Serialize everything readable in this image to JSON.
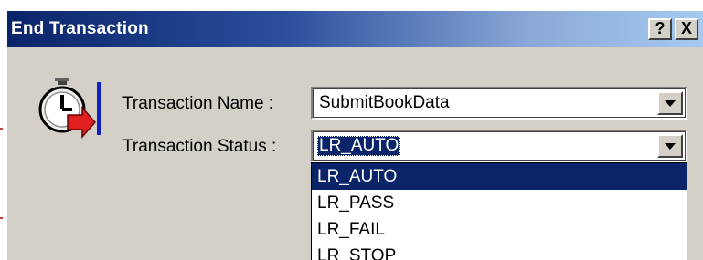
{
  "window": {
    "title": "End Transaction",
    "help_button": "?",
    "close_button": "X"
  },
  "icon": "stopwatch-transaction-icon",
  "form": {
    "name_label": "Transaction Name :",
    "name_value": "SubmitBookData",
    "status_label": "Transaction Status :",
    "status_value": "LR_AUTO"
  },
  "dropdown": {
    "options": [
      "LR_AUTO",
      "LR_PASS",
      "LR_FAIL",
      "LR_STOP"
    ],
    "highlighted": "LR_AUTO"
  },
  "colors": {
    "title_bar_start": "#0a246a",
    "title_bar_end": "#a6caf0",
    "selection": "#0a246a",
    "dialog_face": "#d4d0c8",
    "icon_arrow": "#e02020",
    "icon_bar": "#1020c0"
  }
}
